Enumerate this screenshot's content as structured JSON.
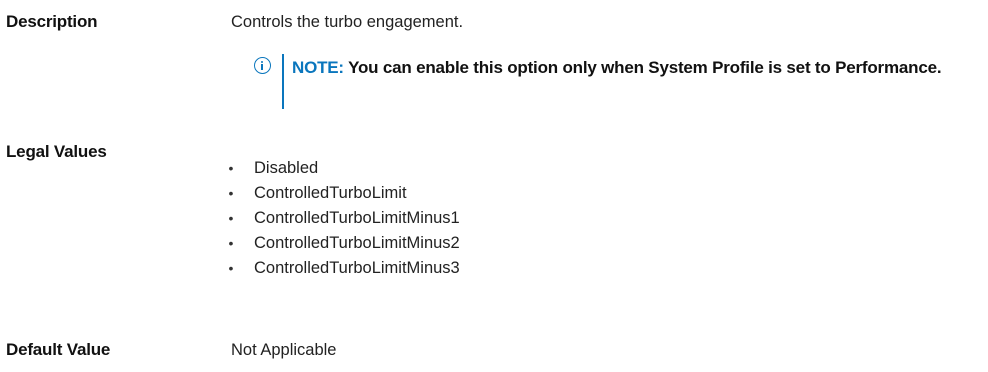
{
  "description": {
    "label": "Description",
    "value": "Controls the turbo engagement."
  },
  "note": {
    "icon": "info-icon",
    "prefix": "NOTE: ",
    "text": "You can enable this option only when System Profile is set to Performance.",
    "accent_color": "#0a76bd"
  },
  "legal_values": {
    "label": "Legal Values",
    "bullet": "•",
    "items": [
      "Disabled",
      "ControlledTurboLimit",
      "ControlledTurboLimitMinus1",
      "ControlledTurboLimitMinus2",
      "ControlledTurboLimitMinus3"
    ]
  },
  "default_value": {
    "label": "Default Value",
    "value": "Not Applicable"
  }
}
